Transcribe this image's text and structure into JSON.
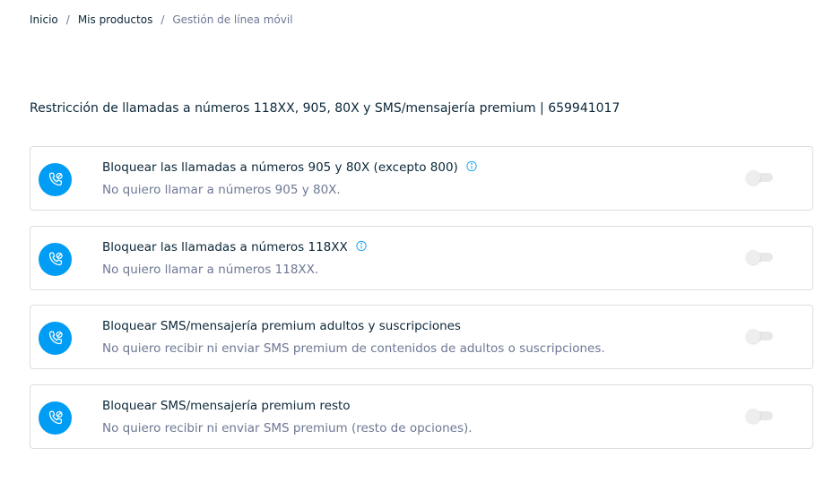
{
  "breadcrumb": {
    "home": "Inicio",
    "products": "Mis productos",
    "current": "Gestión de línea móvil",
    "separator": "/"
  },
  "page_title": "Restricción de llamadas a números 118XX, 905, 80X y SMS/mensajería premium | 659941017",
  "colors": {
    "accent": "#019df4",
    "text": "#0b2739",
    "muted": "#6e7894",
    "border": "#dddddd"
  },
  "restrictions": [
    {
      "title": "Bloquear las llamadas a números 905 y 80X (excepto 800)",
      "description": "No quiero llamar a números 905 y 80X.",
      "icon": "phone-block-icon",
      "has_info": true,
      "enabled": false
    },
    {
      "title": "Bloquear las llamadas a números 118XX",
      "description": "No quiero llamar a números 118XX.",
      "icon": "phone-block-icon",
      "has_info": true,
      "enabled": false
    },
    {
      "title": "Bloquear SMS/mensajería premium adultos y suscripciones",
      "description": "No quiero recibir ni enviar SMS premium de contenidos de adultos o suscripciones.",
      "icon": "phone-block-icon",
      "has_info": false,
      "enabled": false
    },
    {
      "title": "Bloquear SMS/mensajería premium resto",
      "description": "No quiero recibir ni enviar SMS premium (resto de opciones).",
      "icon": "phone-block-icon",
      "has_info": false,
      "enabled": false
    }
  ]
}
